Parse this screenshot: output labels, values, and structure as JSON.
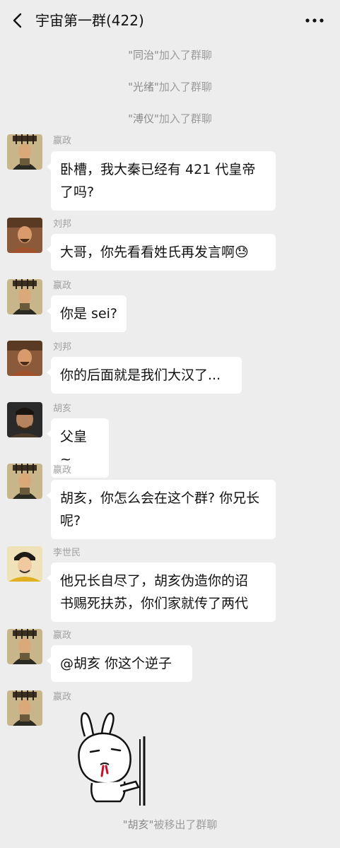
{
  "header": {
    "back_label": "<",
    "title": "宇宙第一群(422)",
    "more_label": "···"
  },
  "system": [
    {
      "quoted": "\"同治\"",
      "text": "加入了群聊"
    },
    {
      "quoted": "\"光绪\"",
      "text": "加入了群聊"
    },
    {
      "quoted": "\"溥仪\"",
      "text": "加入了群聊"
    },
    {
      "quoted": "\"胡亥\"",
      "text": "被移出了群聊"
    }
  ],
  "messages": [
    {
      "sender": "嬴政",
      "lines": [
        "卧槽，我大秦已经有 421 代皇帝",
        "了吗?"
      ],
      "avatar": "qin-emperor-avatar"
    },
    {
      "sender": "刘邦",
      "lines": [
        "大哥，你先看看姓氏再发言啊😓"
      ],
      "avatar": "han-emperor-avatar"
    },
    {
      "sender": "嬴政",
      "lines": [
        "你是 sei?"
      ],
      "avatar": "qin-emperor-avatar"
    },
    {
      "sender": "刘邦",
      "lines": [
        "你的后面就是我们大汉了..."
      ],
      "avatar": "han-emperor-avatar"
    },
    {
      "sender": "胡亥",
      "lines": [
        "父皇 ~"
      ],
      "avatar": "huhai-avatar"
    },
    {
      "sender": "嬴政",
      "lines": [
        "胡亥，你怎么会在这个群? 你兄长",
        "呢?"
      ],
      "avatar": "qin-emperor-avatar"
    },
    {
      "sender": "李世民",
      "lines": [
        "他兄长自尽了，胡亥伪造你的诏",
        "书赐死扶苏，你们家就传了两代"
      ],
      "avatar": "tang-emperor-avatar"
    },
    {
      "sender": "嬴政",
      "lines": [
        "@胡亥  你这个逆子"
      ],
      "avatar": "qin-emperor-avatar"
    },
    {
      "sender": "嬴政",
      "lines": [],
      "avatar": "qin-emperor-avatar",
      "sticker": "rabbit-bleeding-sticker"
    }
  ],
  "colors": {
    "background": "#ededed",
    "bubble": "#ffffff",
    "system_text": "#9b9b9b",
    "sender_text": "#a0a0a0"
  }
}
